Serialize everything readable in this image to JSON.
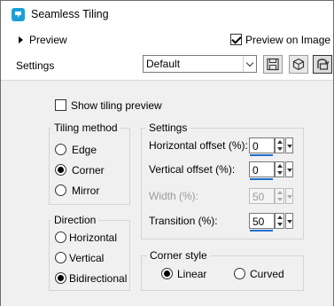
{
  "window": {
    "title": "Seamless Tiling",
    "icon": "seamless-tiling-app-icon"
  },
  "header": {
    "preview_label": "Preview",
    "preview_on_image_label": "Preview on Image",
    "preview_on_image_checked": true,
    "settings_label": "Settings",
    "preset_value": "Default",
    "buttons": {
      "save_icon": "save-preset-icon",
      "cube_icon": "randomize-icon",
      "reset_icon": "reset-icon"
    }
  },
  "main": {
    "show_tiling_preview_label": "Show tiling preview",
    "show_tiling_preview_checked": false,
    "tiling_method": {
      "title": "Tiling method",
      "options": [
        "Edge",
        "Corner",
        "Mirror"
      ],
      "selected": "Corner"
    },
    "direction": {
      "title": "Direction",
      "options": [
        "Horizontal",
        "Vertical",
        "Bidirectional"
      ],
      "selected": "Bidirectional"
    },
    "settings": {
      "title": "Settings",
      "horizontal_offset": {
        "label": "Horizontal offset (%):",
        "value": "0"
      },
      "vertical_offset": {
        "label": "Vertical offset (%):",
        "value": "0"
      },
      "width": {
        "label": "Width (%):",
        "value": "50",
        "enabled": false
      },
      "transition": {
        "label": "Transition (%):",
        "value": "50"
      }
    },
    "corner_style": {
      "title": "Corner style",
      "options": [
        "Linear",
        "Curved"
      ],
      "selected": "Linear"
    }
  },
  "colors": {
    "accent": "#1f6fd0",
    "app_icon": "#1aa0d8"
  }
}
